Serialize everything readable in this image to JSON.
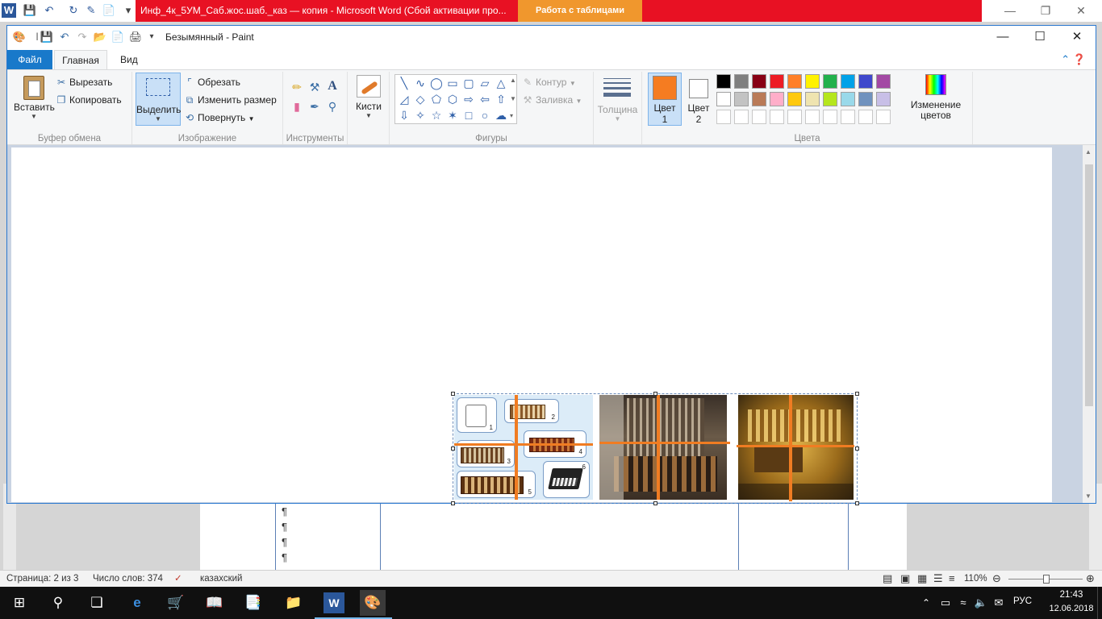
{
  "word": {
    "red_title": "Инф_4к_5УМ_Саб.жос.шаб._каз — копия  -  Microsoft Word (Сбой активации про...",
    "table_tools": "Работа с таблицами",
    "pilcrow": "¶",
    "status": {
      "page": "Страница: 2 из 3",
      "words": "Число слов: 374",
      "language": "казахский",
      "zoom": "110%"
    }
  },
  "paint": {
    "title": "Безымянный - Paint",
    "tabs": {
      "file": "Файл",
      "home": "Главная",
      "view": "Вид"
    },
    "clipboard": {
      "paste": "Вставить",
      "cut": "Вырезать",
      "copy": "Копировать",
      "label": "Буфер обмена"
    },
    "image": {
      "select": "Выделить",
      "crop": "Обрезать",
      "resize": "Изменить размер",
      "rotate": "Повернуть",
      "label": "Изображение"
    },
    "tools": {
      "label": "Инструменты"
    },
    "brushes": {
      "label": "Кисти"
    },
    "shapes": {
      "outline": "Контур",
      "fill": "Заливка",
      "label": "Фигуры"
    },
    "thickness": {
      "label": "Толщина"
    },
    "colors": {
      "color1_label": "Цвет",
      "color1_num": "1",
      "color2_label": "Цвет",
      "color2_num": "2",
      "edit_line1": "Изменение",
      "edit_line2": "цветов",
      "label": "Цвета",
      "color1": "#f57c21",
      "color2": "#ffffff",
      "palette_row1": [
        "#000000",
        "#7f7f7f",
        "#880015",
        "#ed1c24",
        "#ff7f27",
        "#fff200",
        "#22b14c",
        "#00a2e8",
        "#3f48cc",
        "#a349a4"
      ],
      "palette_row2": [
        "#ffffff",
        "#c3c3c3",
        "#b97a57",
        "#ffaec9",
        "#ffc90e",
        "#efe4b0",
        "#b5e61d",
        "#99d9ea",
        "#7092be",
        "#c8bfe7"
      ]
    }
  },
  "taskbar": {
    "language": "РУС",
    "time": "21:43",
    "date": "12.06.2018"
  }
}
